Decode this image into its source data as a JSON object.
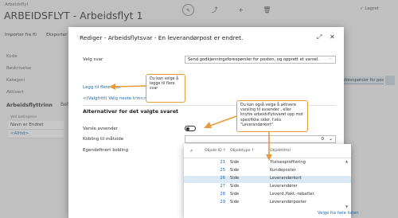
{
  "background": {
    "breadcrumb": "Arbeidsflyt",
    "title": "ARBEIDSFLYT - Arbeidsflyt 1",
    "saved_label": "✓ Lagret",
    "actions": [
      "Importer fra fil",
      "Eksporter"
    ],
    "fields": [
      "Kode",
      "Beskrivelse",
      "Kategori",
      "Aktivert"
    ],
    "right_caption": "jonsforespørsler for poste...",
    "subtab_active": "Arbeidsflyttrinn",
    "subtab_other": "Behandle",
    "list": {
      "header": "Ved betingelse",
      "rows": [
        "Navn er Endret",
        "<Alltid>"
      ]
    }
  },
  "dialog": {
    "title": "Rediger - Arbeidsflytsvar - En leverandørpost er endret.",
    "select_label": "Velg svar",
    "select_value": "Send godkjenningsforespørsler for posten, og opprett et varsel.",
    "add_more_link": "Legg til flere svar",
    "next_step_link": "<(Valgfritt) Velg neste trinn>",
    "section_title": "Alternativer for det valgte svaret",
    "options": [
      {
        "label": "Varsle avsender"
      },
      {
        "label": "Kobling til måtside",
        "value": "0"
      },
      {
        "label": "Egendefinert kobling"
      }
    ]
  },
  "lookup": {
    "headers": [
      "Objekt-ID ↑",
      "Objekttype ↑",
      "Objekttittel"
    ],
    "rows": [
      {
        "id": "21",
        "type": "Side",
        "name": "Ytelsesprofilering"
      },
      {
        "id": "25",
        "type": "Side",
        "name": "Kundeposter"
      },
      {
        "id": "26",
        "type": "Side",
        "name": "Leverandørkort"
      },
      {
        "id": "27",
        "type": "Side",
        "name": "Leverandører"
      },
      {
        "id": "28",
        "type": "Side",
        "name": "Leverd./fakt.-rabatter"
      },
      {
        "id": "29",
        "type": "Side",
        "name": "Leverandørposter"
      }
    ],
    "footer_link": "Velge fra hele listen"
  },
  "callouts": {
    "one": "Du kan velge å legge til flere svar",
    "two": "Du kan også velge å aktivere varsling til avsender , eller knytte arbeidsflytsvaret opp mot spesifikke sider, f.eks \"Leverandørkort\""
  },
  "colors": {
    "accent": "#1f6aa5",
    "callout_border": "#e89a3c",
    "selected_row": "#dbe9f5"
  }
}
